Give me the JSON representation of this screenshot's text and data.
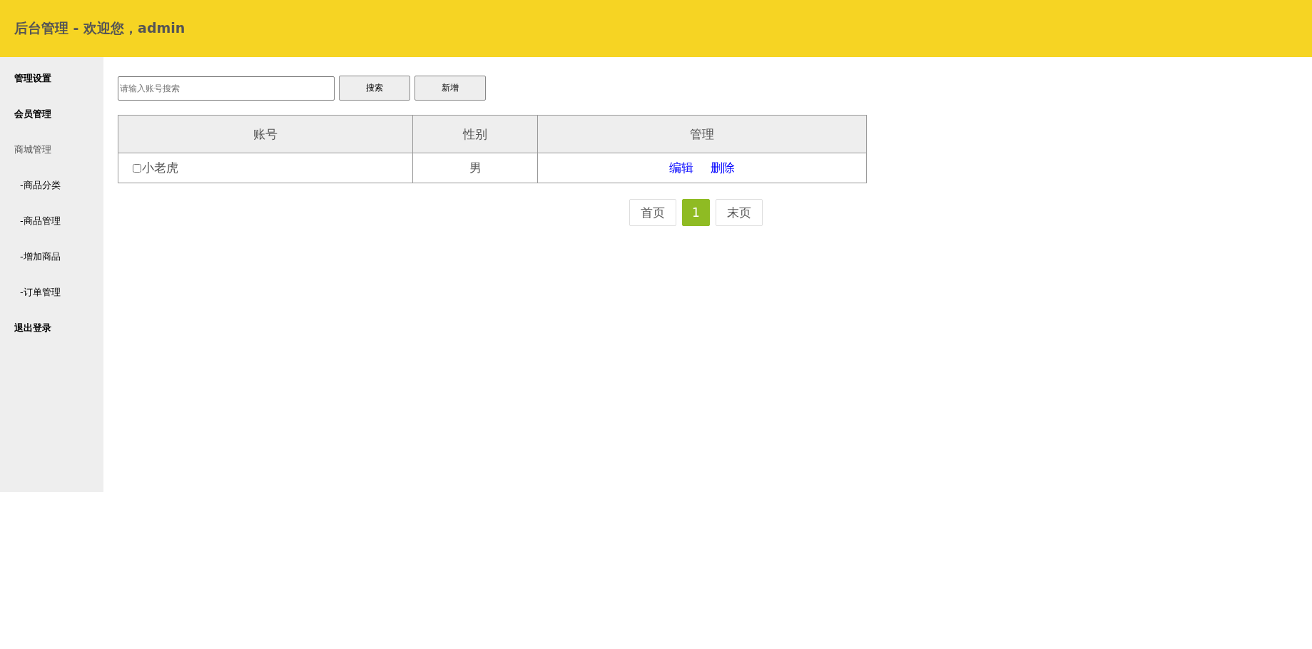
{
  "header": {
    "title": "后台管理 - 欢迎您，admin"
  },
  "sidebar": {
    "items": [
      {
        "label": "管理设置",
        "kind": "link"
      },
      {
        "label": "会员管理",
        "kind": "link"
      },
      {
        "label": "商城管理",
        "kind": "group"
      },
      {
        "label": "-商品分类",
        "kind": "sub"
      },
      {
        "label": "-商品管理",
        "kind": "sub"
      },
      {
        "label": "-增加商品",
        "kind": "sub"
      },
      {
        "label": "-订单管理",
        "kind": "sub"
      },
      {
        "label": "退出登录",
        "kind": "link"
      }
    ]
  },
  "toolbar": {
    "search": {
      "placeholder": "请输入账号搜索"
    },
    "buttons": [
      "搜索",
      "新增"
    ]
  },
  "table": {
    "columns": [
      "账号",
      "性别",
      "管理"
    ],
    "rows": [
      {
        "account": "小老虎",
        "checked": false,
        "gender": "男",
        "actions": [
          "编辑",
          "删除"
        ]
      }
    ]
  },
  "pagination": [
    {
      "label": "首页",
      "selected": false
    },
    {
      "label": "1",
      "selected": true
    },
    {
      "label": "末页",
      "selected": false
    }
  ]
}
